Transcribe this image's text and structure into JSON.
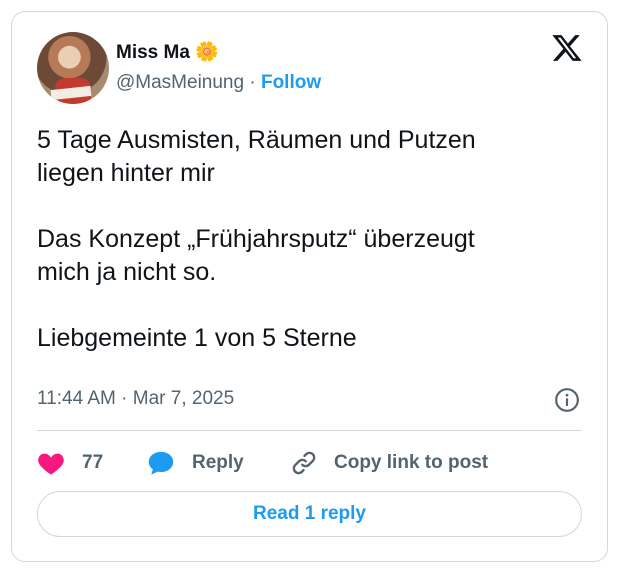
{
  "author": {
    "name": "Miss Ma 🌼",
    "handle": "@MasMeinung",
    "separator": "·",
    "follow_label": "Follow"
  },
  "tweet": {
    "text": "5 Tage Ausmisten, Räumen und Putzen\nliegen hinter mir\n\nDas Konzept „Frühjahrsputz“ überzeugt\nmich ja nicht so.\n\nLiebgemeinte 1 von 5 Sterne",
    "time": "11:44 AM",
    "separator": "·",
    "date": "Mar 7, 2025"
  },
  "actions": {
    "like_count": "77",
    "reply_label": "Reply",
    "copy_link_label": "Copy link to post"
  },
  "read_replies_label": "Read 1 reply",
  "icons": {
    "logo": "x-logo-icon",
    "info": "info-icon",
    "like": "heart-icon",
    "reply": "speech-bubble-icon",
    "copy": "link-icon"
  },
  "colors": {
    "accent": "#1d9bf0",
    "like": "#f91880",
    "text": "#0f1419",
    "muted": "#536471",
    "border": "#cfd9de"
  }
}
